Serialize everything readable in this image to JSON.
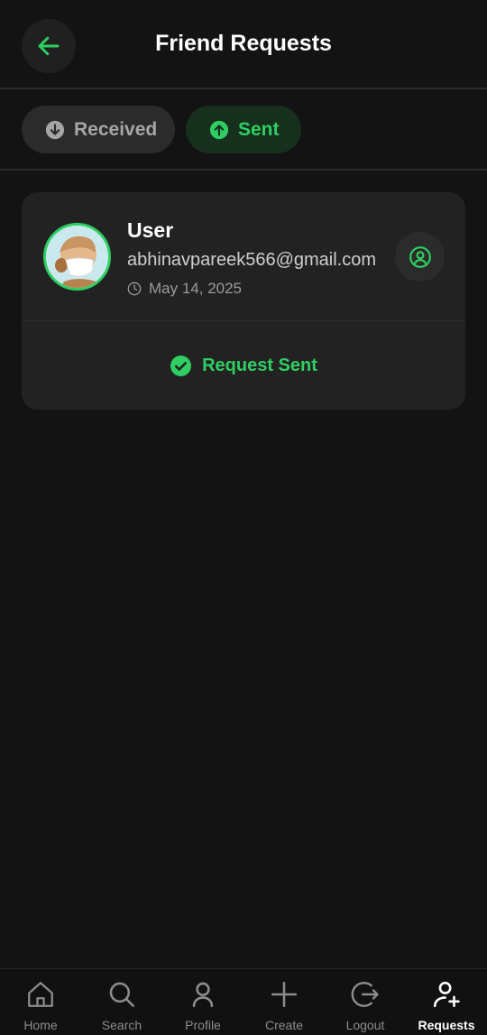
{
  "header": {
    "title": "Friend Requests",
    "back_icon": "arrow-left-icon"
  },
  "tabs": [
    {
      "label": "Received",
      "icon": "arrow-down-circle-icon",
      "active": false
    },
    {
      "label": "Sent",
      "icon": "arrow-up-circle-icon",
      "active": true
    }
  ],
  "request": {
    "name": "User",
    "email": "abhinavpareek566@gmail.com",
    "date": "May 14, 2025",
    "status": "Request Sent"
  },
  "nav": [
    {
      "label": "Home",
      "icon": "home-icon"
    },
    {
      "label": "Search",
      "icon": "search-icon"
    },
    {
      "label": "Profile",
      "icon": "profile-icon"
    },
    {
      "label": "Create",
      "icon": "plus-icon"
    },
    {
      "label": "Logout",
      "icon": "logout-icon"
    },
    {
      "label": "Requests",
      "icon": "user-add-icon",
      "active": true
    }
  ],
  "colors": {
    "accent": "#2fce62",
    "background": "#131313",
    "card": "#222222"
  }
}
